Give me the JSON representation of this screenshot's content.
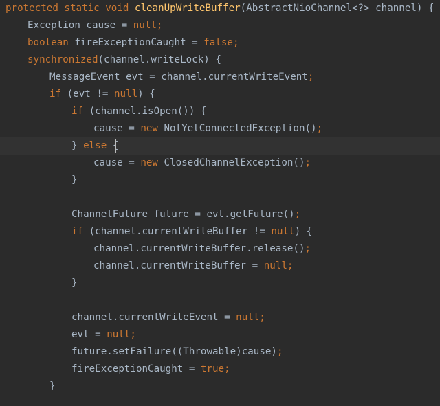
{
  "colors": {
    "background": "#2b2b2b",
    "current_line": "#323232",
    "keyword": "#cc7832",
    "method_declaration": "#ffc66d",
    "plain_text": "#a9b7c6",
    "indent_guide": "#3b3b3b",
    "caret": "#bbbbbb"
  },
  "editor": {
    "caret_line": 9,
    "lines": [
      {
        "indent": 0,
        "tokens": [
          {
            "t": "protected static void ",
            "k": "kw"
          },
          {
            "t": "cleanUpWriteBuffer",
            "k": "fn"
          },
          {
            "t": "(AbstractNioChannel<?> channel) {",
            "k": "pl"
          }
        ]
      },
      {
        "indent": 1,
        "tokens": [
          {
            "t": "Exception cause = ",
            "k": "pl"
          },
          {
            "t": "null",
            "k": "kw"
          },
          {
            "t": ";",
            "k": "semi"
          }
        ]
      },
      {
        "indent": 1,
        "tokens": [
          {
            "t": "boolean ",
            "k": "kw"
          },
          {
            "t": "fireExceptionCaught = ",
            "k": "pl"
          },
          {
            "t": "false",
            "k": "kw"
          },
          {
            "t": ";",
            "k": "semi"
          }
        ]
      },
      {
        "indent": 1,
        "tokens": [
          {
            "t": "synchronized",
            "k": "kw"
          },
          {
            "t": "(channel.writeLock) {",
            "k": "pl"
          }
        ]
      },
      {
        "indent": 2,
        "tokens": [
          {
            "t": "MessageEvent evt = channel.currentWriteEvent",
            "k": "pl"
          },
          {
            "t": ";",
            "k": "semi"
          }
        ]
      },
      {
        "indent": 2,
        "tokens": [
          {
            "t": "if ",
            "k": "kw"
          },
          {
            "t": "(evt != ",
            "k": "pl"
          },
          {
            "t": "null",
            "k": "kw"
          },
          {
            "t": ") {",
            "k": "pl"
          }
        ]
      },
      {
        "indent": 3,
        "tokens": [
          {
            "t": "if ",
            "k": "kw"
          },
          {
            "t": "(channel.isOpen()) {",
            "k": "pl"
          }
        ]
      },
      {
        "indent": 4,
        "tokens": [
          {
            "t": "cause = ",
            "k": "pl"
          },
          {
            "t": "new ",
            "k": "kw"
          },
          {
            "t": "NotYetConnectedException()",
            "k": "pl"
          },
          {
            "t": ";",
            "k": "semi"
          }
        ]
      },
      {
        "indent": 3,
        "tokens": [
          {
            "t": "} ",
            "k": "pl"
          },
          {
            "t": "else ",
            "k": "kw"
          },
          {
            "t": "{",
            "k": "pl"
          }
        ]
      },
      {
        "indent": 4,
        "tokens": [
          {
            "t": "cause = ",
            "k": "pl"
          },
          {
            "t": "new ",
            "k": "kw"
          },
          {
            "t": "ClosedChannelException()",
            "k": "pl"
          },
          {
            "t": ";",
            "k": "semi"
          }
        ]
      },
      {
        "indent": 3,
        "tokens": [
          {
            "t": "}",
            "k": "pl"
          }
        ]
      },
      {
        "indent": 0,
        "tokens": []
      },
      {
        "indent": 3,
        "tokens": [
          {
            "t": "ChannelFuture future = evt.getFuture()",
            "k": "pl"
          },
          {
            "t": ";",
            "k": "semi"
          }
        ]
      },
      {
        "indent": 3,
        "tokens": [
          {
            "t": "if ",
            "k": "kw"
          },
          {
            "t": "(channel.currentWriteBuffer != ",
            "k": "pl"
          },
          {
            "t": "null",
            "k": "kw"
          },
          {
            "t": ") {",
            "k": "pl"
          }
        ]
      },
      {
        "indent": 4,
        "tokens": [
          {
            "t": "channel.currentWriteBuffer.release()",
            "k": "pl"
          },
          {
            "t": ";",
            "k": "semi"
          }
        ]
      },
      {
        "indent": 4,
        "tokens": [
          {
            "t": "channel.currentWriteBuffer = ",
            "k": "pl"
          },
          {
            "t": "null",
            "k": "kw"
          },
          {
            "t": ";",
            "k": "semi"
          }
        ]
      },
      {
        "indent": 3,
        "tokens": [
          {
            "t": "}",
            "k": "pl"
          }
        ]
      },
      {
        "indent": 0,
        "tokens": []
      },
      {
        "indent": 3,
        "tokens": [
          {
            "t": "channel.currentWriteEvent = ",
            "k": "pl"
          },
          {
            "t": "null",
            "k": "kw"
          },
          {
            "t": ";",
            "k": "semi"
          }
        ]
      },
      {
        "indent": 3,
        "tokens": [
          {
            "t": "evt = ",
            "k": "pl"
          },
          {
            "t": "null",
            "k": "kw"
          },
          {
            "t": ";",
            "k": "semi"
          }
        ]
      },
      {
        "indent": 3,
        "tokens": [
          {
            "t": "future.setFailure((Throwable)cause)",
            "k": "pl"
          },
          {
            "t": ";",
            "k": "semi"
          }
        ]
      },
      {
        "indent": 3,
        "tokens": [
          {
            "t": "fireExceptionCaught = ",
            "k": "pl"
          },
          {
            "t": "true",
            "k": "kw"
          },
          {
            "t": ";",
            "k": "semi"
          }
        ]
      },
      {
        "indent": 2,
        "tokens": [
          {
            "t": "}",
            "k": "pl"
          }
        ]
      }
    ]
  }
}
